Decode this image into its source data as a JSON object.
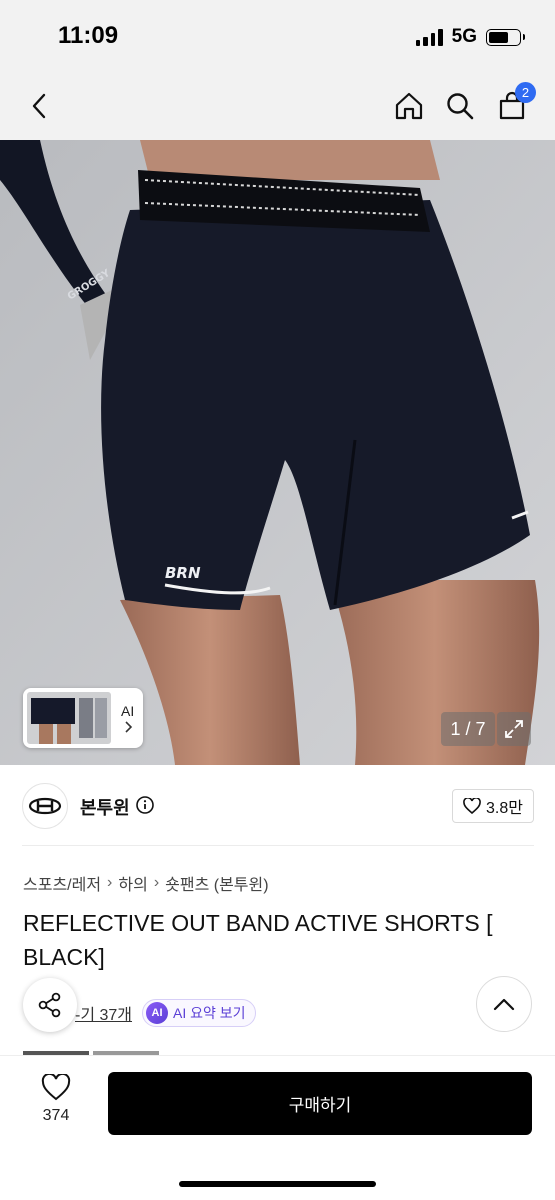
{
  "status_bar": {
    "time": "11:09",
    "network": "5G",
    "battery_level": 0.64
  },
  "nav": {
    "cart_count": "2",
    "icons": [
      "back-icon",
      "home-icon",
      "search-icon",
      "cart-icon"
    ]
  },
  "gallery": {
    "counter": "1 / 7",
    "thumb_label": "AI",
    "garment_text": "BRN",
    "sleeve_text": "GROGGY"
  },
  "brand": {
    "name": "본투윈",
    "likes": "3.8만"
  },
  "breadcrumb": [
    "스포츠/레저",
    "하의",
    "숏팬츠 (본투윈)"
  ],
  "product": {
    "title": "REFLECTIVE OUT BAND ACTIVE SHORTS [ BLACK]"
  },
  "reviews": {
    "link_text": "-기 37개",
    "ai_badge": "AI",
    "ai_summary_label": "AI 요약 보기"
  },
  "bottom": {
    "wish_count": "374",
    "buy_label": "구매하기"
  },
  "colors": {
    "accent_blue": "#2f6bf2",
    "ai_purple": "#5b3fd6",
    "buy_button": "#000000"
  }
}
